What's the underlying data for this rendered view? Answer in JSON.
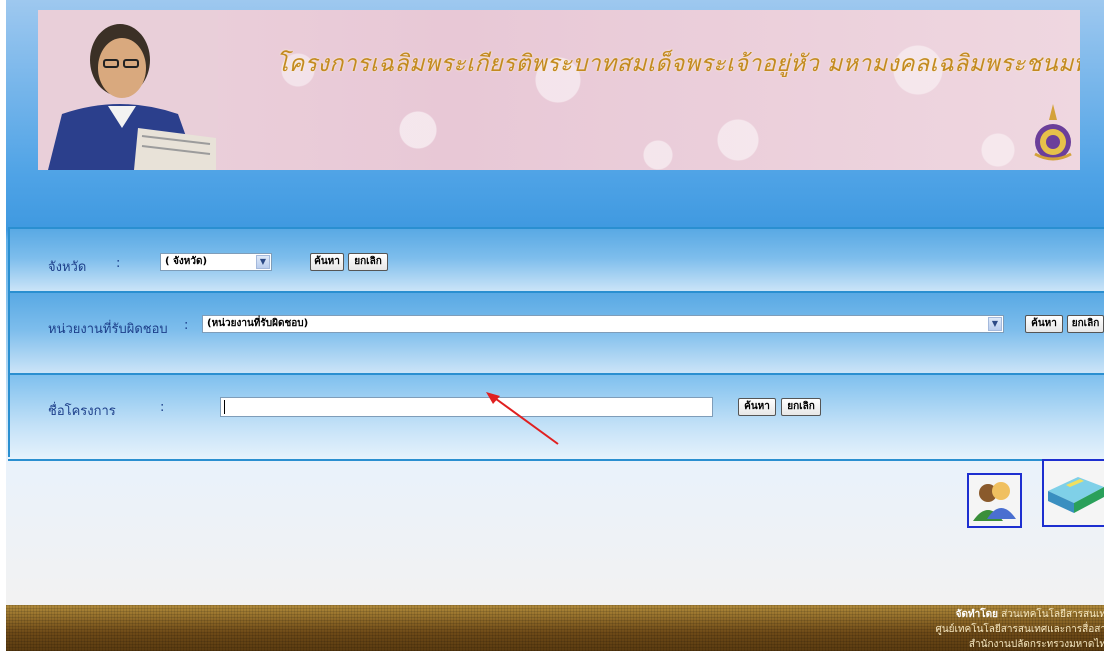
{
  "header": {
    "title": "โครงการเฉลิมพระเกียรติพระบาทสมเด็จพระเจ้าอยู่หัว มหามงคลเฉลิมพระชนมพรรษา"
  },
  "province_row": {
    "label": "จังหวัด",
    "colon": ":",
    "select_value": "( จังหวัด)",
    "search_label": "ค้นหา",
    "cancel_label": "ยกเลิก"
  },
  "agency_row": {
    "label": "หน่วยงานที่รับผิดชอบ",
    "colon": ":",
    "select_value": "(หน่วยงานที่รับผิดชอบ)",
    "search_label": "ค้นหา",
    "cancel_label": "ยกเลิก"
  },
  "project_row": {
    "label": "ชื่อโครงการ",
    "colon": ":",
    "input_value": "",
    "search_label": "ค้นหา",
    "cancel_label": "ยกเลิก"
  },
  "icons": {
    "people": "users-icon",
    "book": "book-icon",
    "select_arrow": "chevron-down-icon"
  },
  "footer": {
    "line1_bold": "จัดทำโดย",
    "line1": "ส่วนเทคโนโลยีสารสนเท",
    "line2": "ศูนย์เทคโนโลยีสารสนเทศและการสื่อสา",
    "line3": "สำนักงานปลัดกระทรวงมหาดไท"
  },
  "colors": {
    "accent_blue": "#2a8fd0",
    "label_blue": "#1d3f8a",
    "banner_text_gold": "#c38a1f",
    "footer_brown": "#6e4a17",
    "annotation_red": "#e02020"
  }
}
